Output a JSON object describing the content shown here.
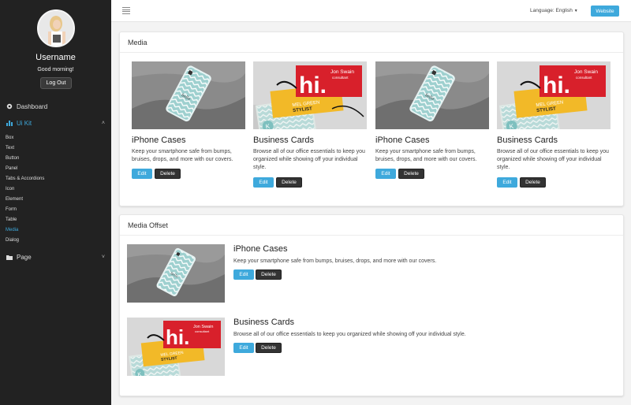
{
  "sidebar": {
    "username": "Username",
    "greeting": "Good morning!",
    "logout_label": "Log Out",
    "nav": [
      {
        "label": "Dashboard",
        "icon": "gear-icon"
      },
      {
        "label": "Ui Kit",
        "icon": "bar-chart-icon"
      },
      {
        "label": "Page",
        "icon": "folder-icon"
      }
    ],
    "subitems": [
      "Box",
      "Text",
      "Button",
      "Panel",
      "Tabs & Accordions",
      "Icon",
      "Element",
      "Form",
      "Table",
      "Media",
      "Dialog"
    ],
    "active_subitem": "Media"
  },
  "topbar": {
    "language_label": "Language:",
    "language_value": "English",
    "website_label": "Website"
  },
  "media": {
    "title": "Media",
    "cards": [
      {
        "title": "iPhone Cases",
        "text": "Keep your smartphone safe from bumps, bruises, drops, and more with our covers.",
        "edit": "Edit",
        "delete": "Delete"
      },
      {
        "title": "Business Cards",
        "text": "Browse all of our office essentials to keep you organized while showing off your individual style.",
        "edit": "Edit",
        "delete": "Delete"
      },
      {
        "title": "iPhone Cases",
        "text": "Keep your smartphone safe from bumps, bruises, drops, and more with our covers.",
        "edit": "Edit",
        "delete": "Delete"
      },
      {
        "title": "Business Cards",
        "text": "Browse all of our office essentials to keep you organized while showing off your individual style.",
        "edit": "Edit",
        "delete": "Delete"
      }
    ]
  },
  "media_offset": {
    "title": "Media Offset",
    "items": [
      {
        "title": "iPhone Cases",
        "text": "Keep your smartphone safe from bumps, bruises, drops, and more with our covers.",
        "edit": "Edit",
        "delete": "Delete"
      },
      {
        "title": "Business Cards",
        "text": "Browse all of our office essentials to keep you organized while showing off your individual style.",
        "edit": "Edit",
        "delete": "Delete"
      }
    ]
  },
  "image_text": {
    "hi": "hi.",
    "name1": "Jon Swain",
    "role1": "consultant",
    "name2": "MEL GREEN",
    "role2": "STYLIST",
    "initial": "K"
  },
  "colors": {
    "accent": "#3ea9dc",
    "sidebar_bg": "#222222",
    "card_red": "#d8202b",
    "card_yellow": "#f2b928"
  }
}
